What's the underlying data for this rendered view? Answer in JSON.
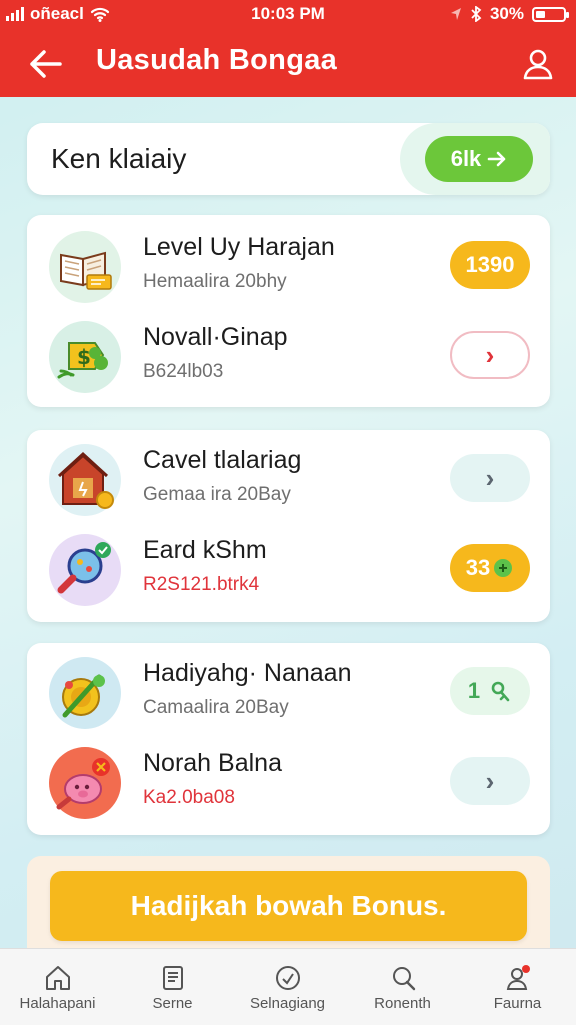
{
  "status_bar": {
    "carrier": "oñeacl",
    "time": "10:03 PM",
    "battery_text": "30%"
  },
  "header": {
    "title": "Uasudah Bongaa"
  },
  "search": {
    "label": "Ken klaiaiy",
    "button_label": "6lk"
  },
  "cards": [
    {
      "rows": [
        {
          "title": "Level Uy Harajan",
          "subtitle": "Hemaalira 20bhy",
          "action": "1390",
          "icon": "book-icon"
        },
        {
          "title": "Novall·Ginap",
          "subtitle": "B624lb03",
          "action": "›",
          "icon": "money-leaf-icon"
        }
      ]
    },
    {
      "rows": [
        {
          "title": "Cavel tlalariag",
          "subtitle": "Gemaa ira 20Bay",
          "action": "›",
          "icon": "house-icon"
        },
        {
          "title": "Eard kShm",
          "subtitle": "R2S121.btrk4",
          "action": "33",
          "icon": "magnifier-icon"
        }
      ]
    },
    {
      "rows": [
        {
          "title": "Hadiyahg· Nanaan",
          "subtitle": "Camaalira 20Bay",
          "action": "1",
          "icon": "coin-brush-icon"
        },
        {
          "title": "Norah Balna",
          "subtitle": "Ka2.0ba08",
          "action": "›",
          "icon": "pig-icon"
        }
      ]
    }
  ],
  "bonus_button": "Hadijkah bowah Bonus.",
  "tabs": [
    {
      "label": "Halahapani",
      "icon": "home-icon"
    },
    {
      "label": "Serne",
      "icon": "document-icon"
    },
    {
      "label": "Selnagiang",
      "icon": "clock-icon"
    },
    {
      "label": "Ronenth",
      "icon": "search-icon"
    },
    {
      "label": "Faurna",
      "icon": "profile-icon"
    }
  ],
  "colors": {
    "header_red": "#e8322a",
    "accent_orange": "#f6b81c",
    "accent_green": "#6cc73a",
    "background_mint": "#d8f1f2"
  }
}
